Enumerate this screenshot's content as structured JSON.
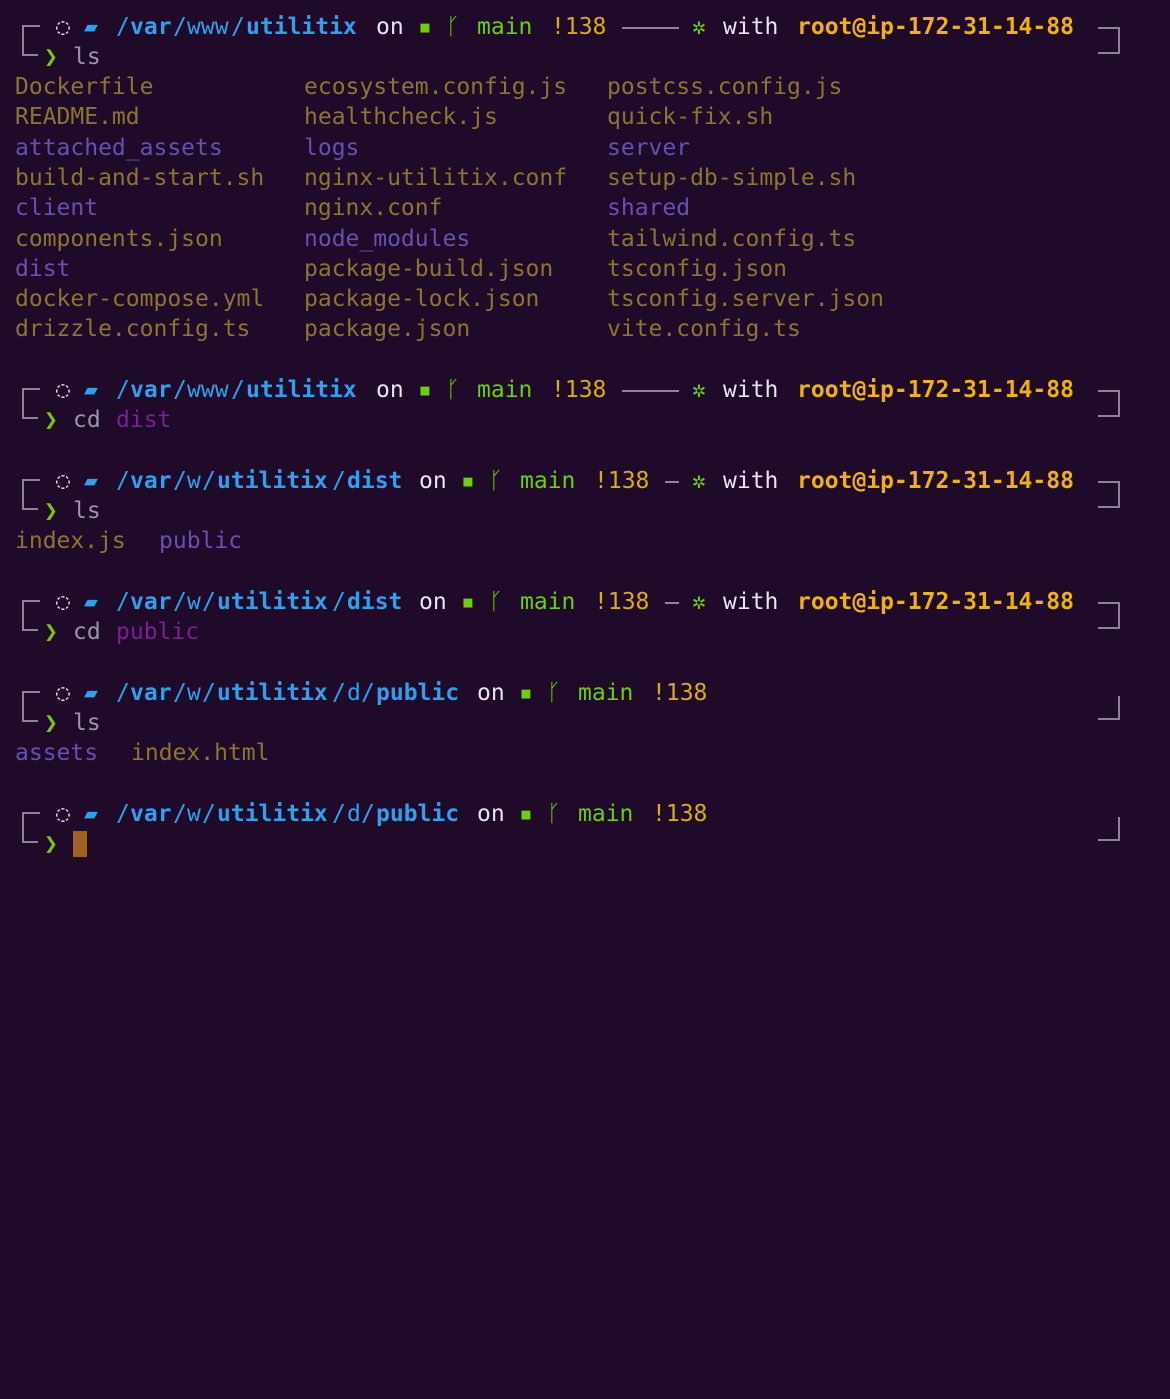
{
  "terminal": {
    "prompts": [
      {
        "path": [
          "/",
          "var",
          "/",
          "www",
          "/",
          "utilitix"
        ],
        "on": "on",
        "branch": "main",
        "status": "!138",
        "with": "with",
        "user": "root@ip-172-31-14-88",
        "command": "ls",
        "argument": ""
      },
      {
        "path": [
          "/",
          "var",
          "/",
          "www",
          "/",
          "utilitix"
        ],
        "on": "on",
        "branch": "main",
        "status": "!138",
        "with": "with",
        "user": "root@ip-172-31-14-88",
        "command": "cd",
        "argument": "dist"
      },
      {
        "path": [
          "/",
          "var",
          "/",
          "w",
          "/",
          "utilitix",
          "/",
          "dist"
        ],
        "on": "on",
        "branch": "main",
        "status": "!138",
        "with": "with",
        "user": "root@ip-172-31-14-88",
        "command": "ls",
        "argument": ""
      },
      {
        "path": [
          "/",
          "var",
          "/",
          "w",
          "/",
          "utilitix",
          "/",
          "dist"
        ],
        "on": "on",
        "branch": "main",
        "status": "!138",
        "with": "with",
        "user": "root@ip-172-31-14-88",
        "command": "cd",
        "argument": "public"
      },
      {
        "path": [
          "/",
          "var",
          "/",
          "w",
          "/",
          "utilitix",
          "/",
          "d",
          "/",
          "public"
        ],
        "on": "on",
        "branch": "main",
        "status": "!138",
        "command": "ls",
        "argument": ""
      },
      {
        "path": [
          "/",
          "var",
          "/",
          "w",
          "/",
          "utilitix",
          "/",
          "d",
          "/",
          "public"
        ],
        "on": "on",
        "branch": "main",
        "status": "!138",
        "command": "",
        "argument": ""
      }
    ],
    "ls_root": {
      "col1": [
        "Dockerfile",
        "README.md",
        "attached_assets",
        "build-and-start.sh",
        "client",
        "components.json",
        "dist",
        "docker-compose.yml",
        "drizzle.config.ts"
      ],
      "col2": [
        "ecosystem.config.js",
        "healthcheck.js",
        "logs",
        "nginx-utilitix.conf",
        "nginx.conf",
        "node_modules",
        "package-build.json",
        "package-lock.json",
        "package.json"
      ],
      "col3": [
        "postcss.config.js",
        "quick-fix.sh",
        "server",
        "setup-db-simple.sh",
        "shared",
        "tailwind.config.ts",
        "tsconfig.json",
        "tsconfig.server.json",
        "vite.config.ts"
      ]
    },
    "ls_dist": [
      "index.js",
      "public"
    ],
    "ls_public": [
      "assets",
      "index.html"
    ],
    "icons": {
      "status": "circle-dot-icon",
      "folder": "folder-icon",
      "git": "github-icon",
      "branch": "git-branch-icon",
      "gear": "gear-icon",
      "prompt": "chevron-right-icon"
    },
    "colors": {
      "background": "#1f0a2a",
      "path": "#2aa3ef",
      "git": "#6bd100",
      "status": "#d7b000",
      "user": "#f0b400",
      "file": "#8b7530",
      "directory": "#6650b0",
      "argument": "#7a1f96",
      "cursor": "#a0621e"
    }
  }
}
